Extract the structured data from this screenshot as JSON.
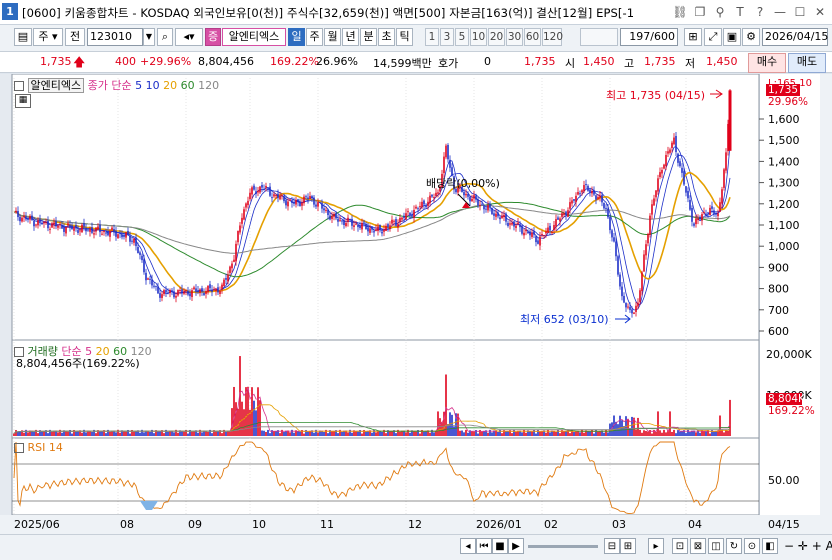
{
  "title_bar": {
    "app_number": "1",
    "text": "[0600] 키움종합차트 - KOSDAQ 외국인보유[0(천)] 주식수[32,659(천)] 액면[500] 자본금[163(억)] 결산[12월] EPS[-1"
  },
  "toolbar": {
    "type_label": "주",
    "prev_label": "전",
    "code_value": "123010",
    "stock_badge": "증",
    "stock_name": "알엔티엑스",
    "periods": [
      "일",
      "주",
      "월",
      "년",
      "분",
      "초",
      "틱"
    ],
    "selected_period": "일",
    "minutes": [
      "1",
      "3",
      "5",
      "10",
      "20",
      "30",
      "60",
      "120"
    ],
    "count_value": "197/600",
    "date_value": "2026/04/15"
  },
  "quote": {
    "price": "1,735",
    "change": "400",
    "change_pct": "+29.96%",
    "volume": "8,804,456",
    "volume_pct": "169.22%",
    "turnover": "26.96%",
    "amount": "14,599백만",
    "hoga_label": "호가",
    "hoga_value": "0",
    "cur": "1,735",
    "open_label": "시",
    "open": "1,450",
    "high_label": "고",
    "high": "1,735",
    "low_label": "저",
    "low": "1,450",
    "buy_label": "매수",
    "sell_label": "매도"
  },
  "price_panel": {
    "stock_tag": "알엔티엑스",
    "legend_title": "종가 단순",
    "ma": [
      {
        "label": "5",
        "color": "#1c2ec8"
      },
      {
        "label": "10",
        "color": "#1c2ec8"
      },
      {
        "label": "20",
        "color": "#e5a000"
      },
      {
        "label": "60",
        "color": "#2e8b2e"
      },
      {
        "label": "120",
        "color": "#888888"
      }
    ],
    "high_annotation": "최고 1,735 (04/15)",
    "low_annotation": "최저 652 (03/10)",
    "mid_annotation": "배당락(0,00%)",
    "top_clip_label": "L:165.10",
    "last_price_tag": "1,735",
    "last_pct_tag": "29.96%",
    "y_ticks": [
      "1,600",
      "1,500",
      "1,400",
      "1,300",
      "1,200",
      "1,100",
      "1,000",
      "900",
      "800",
      "700",
      "600"
    ]
  },
  "volume_panel": {
    "legend_title": "거래량",
    "legend_sub": "단순",
    "ma": [
      {
        "label": "5",
        "color": "#d6328c"
      },
      {
        "label": "20",
        "color": "#e5a000"
      },
      {
        "label": "60",
        "color": "#2e8b2e"
      },
      {
        "label": "120",
        "color": "#888888"
      }
    ],
    "value_line": "8,804,456주(169.22%)",
    "y_ticks": [
      "20,000K",
      "10,000K"
    ],
    "last_vol_tag": "8,804K",
    "last_vol_pct": "169.22%"
  },
  "rsi_panel": {
    "legend": "RSI 14",
    "y_ticks": [
      "50.00"
    ]
  },
  "x_axis": {
    "labels": [
      "2025/06",
      "08",
      "09",
      "10",
      "11",
      "12",
      "2026/01",
      "02",
      "03",
      "04"
    ],
    "right_label": "04/15"
  },
  "colors": {
    "up": "#e0001a",
    "down": "#1c2ec8",
    "rsi": "#e07a10"
  }
}
